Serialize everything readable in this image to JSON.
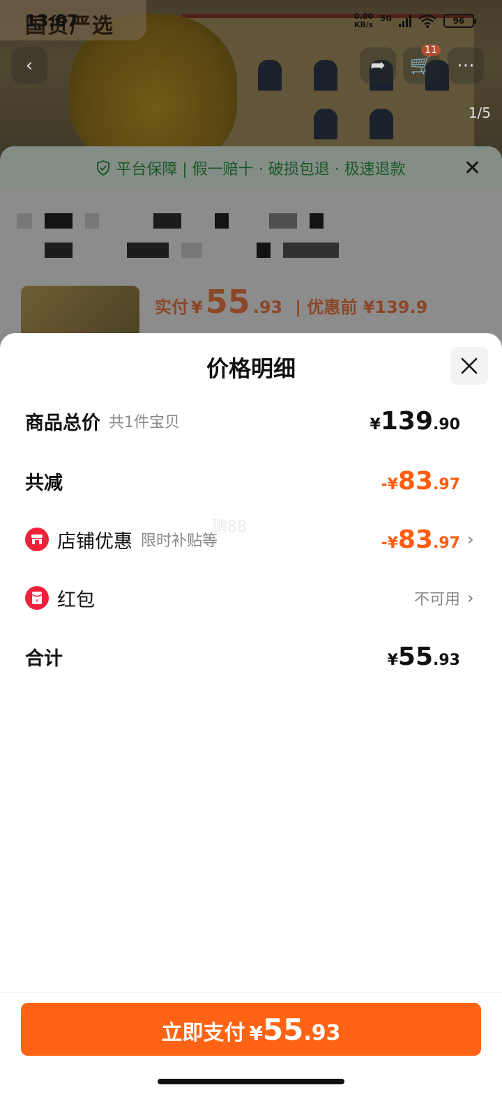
{
  "status_bar": {
    "time": "13:07",
    "net_speed_value": "0.00",
    "net_speed_unit": "KB/s",
    "network": "5G",
    "battery": "96"
  },
  "background": {
    "brand": "国货严选",
    "cart_count": "11",
    "pager": "1/5",
    "guarantee_text": "平台保障 | 假一赔十 · 破损包退 · 极速退款",
    "order_pay_label": "实付",
    "order_currency": "¥",
    "order_price_int": "55",
    "order_price_dec": ".93",
    "order_before_label": "| 优惠前 ¥139.9"
  },
  "sheet": {
    "title": "价格明细",
    "watermark": "鹏88",
    "rows": [
      {
        "label": "商品总价",
        "sub": "共1件宝贝",
        "currency": "¥",
        "int": "139",
        "dec": ".90"
      },
      {
        "label": "共减",
        "currency": "-¥",
        "int": "83",
        "dec": ".97"
      },
      {
        "label": "店铺优惠",
        "sub": "限时补贴等",
        "currency": "-¥",
        "int": "83",
        "dec": ".97"
      },
      {
        "label": "红包",
        "status": "不可用"
      },
      {
        "label": "合计",
        "currency": "¥",
        "int": "55",
        "dec": ".93"
      }
    ]
  },
  "pay_button": {
    "label": "立即支付",
    "currency": "¥",
    "int": "55",
    "dec": ".93"
  },
  "colors": {
    "accent": "#ff6313",
    "discount": "#ff5c10",
    "coupon_icon": "#f2213a",
    "guarantee": "#2f9a45"
  },
  "icons": {
    "shop": "shop-icon",
    "red_packet": "red-packet-icon",
    "close": "close-icon",
    "chevron": "chevron-right-icon"
  }
}
